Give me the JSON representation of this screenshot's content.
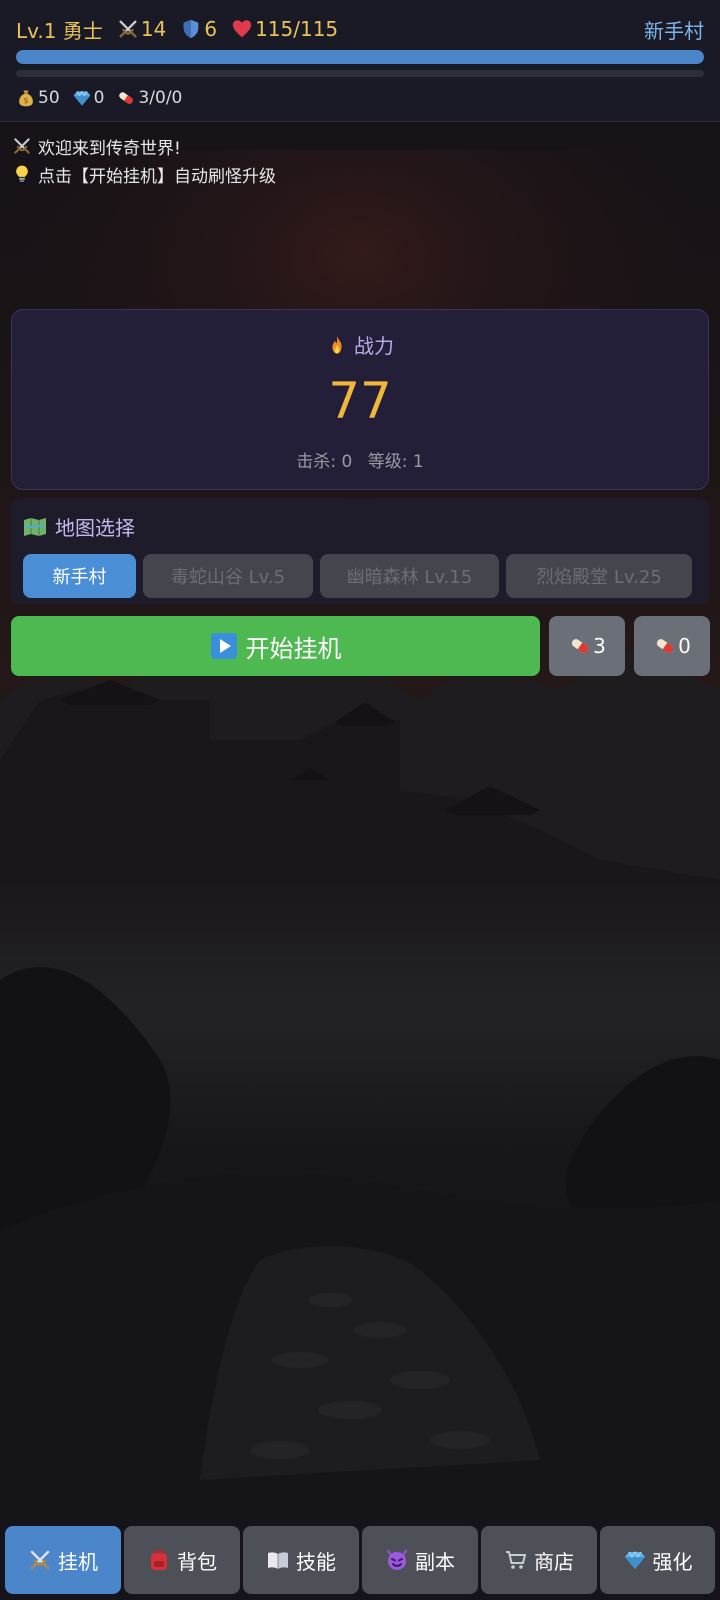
{
  "header": {
    "level": "Lv.1",
    "class_name": "勇士",
    "attack": "14",
    "defense": "6",
    "hp": "115/115",
    "hp_ratio": 1.0,
    "exp_ratio": 0.0,
    "location": "新手村",
    "gold": "50",
    "diamonds": "0",
    "potions": "3/0/0"
  },
  "log": [
    {
      "icon": "crossed-swords-icon",
      "text": "欢迎来到传奇世界!"
    },
    {
      "icon": "lightbulb-icon",
      "text": "点击【开始挂机】自动刷怪升级"
    }
  ],
  "power": {
    "title": "战力",
    "value": "77",
    "kills_label": "击杀: 0",
    "level_label": "等级: 1"
  },
  "maps": {
    "title": "地图选择",
    "tabs": [
      "新手村",
      "毒蛇山谷 Lv.5",
      "幽暗森林 Lv.15",
      "烈焰殿堂 Lv.25"
    ],
    "selected": "新手村"
  },
  "actions": {
    "start_label": "开始挂机",
    "potion_small": "3",
    "potion_large": "0"
  },
  "nav": {
    "items": [
      "挂机",
      "背包",
      "技能",
      "副本",
      "商店",
      "强化"
    ],
    "icons": [
      "crossed-swords-icon",
      "backpack-icon",
      "book-icon",
      "demon-icon",
      "cart-icon",
      "gem-icon"
    ],
    "active": "挂机"
  },
  "colors": {
    "accent": "#4a86c9",
    "gold": "#f0b73a",
    "start_button": "#4eb851"
  }
}
